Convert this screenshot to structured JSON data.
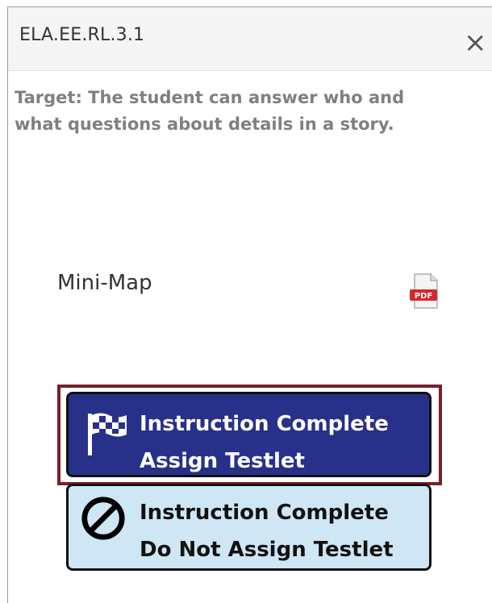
{
  "header": {
    "title": "ELA.EE.RL.3.1",
    "close_label": "×"
  },
  "target": {
    "text": "Target: The student can answer who and what questions about details in a story."
  },
  "minimap": {
    "label": "Mini-Map",
    "icon": "pdf-icon",
    "icon_text": "PDF"
  },
  "buttons": {
    "assign": {
      "line1": "Instruction Complete",
      "line2": "Assign Testlet",
      "icon": "checkered-flag-icon",
      "color": "#27318a",
      "highlight_color": "#7a1f2b"
    },
    "not_assign": {
      "line1": "Instruction Complete",
      "line2": "Do Not Assign Testlet",
      "icon": "prohibited-icon",
      "color": "#cfe6f4"
    }
  }
}
